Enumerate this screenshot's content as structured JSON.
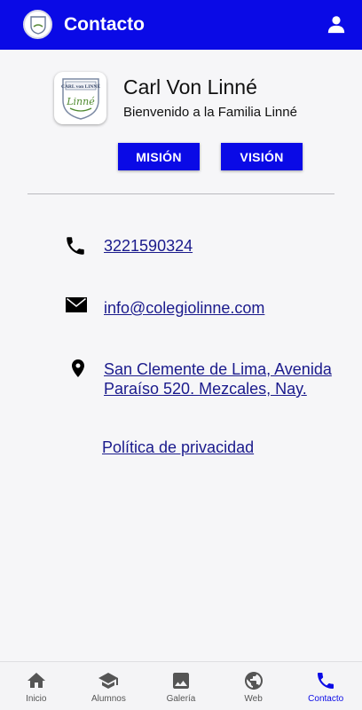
{
  "appbar": {
    "title": "Contacto",
    "logo_icon": "school-crest-icon",
    "profile_icon": "person-icon",
    "color": "#0a0ae6"
  },
  "header": {
    "logo_text_top": "CARL von LINNÉ",
    "logo_text_script": "Linné",
    "name": "Carl Von Linné",
    "welcome": "Bienvenido a la Familia Linné"
  },
  "buttons": {
    "mision": "MISIÓN",
    "vision": "VISIÓN"
  },
  "contact": {
    "phone": {
      "icon": "phone-icon",
      "text": "3221590324"
    },
    "email": {
      "icon": "envelope-icon",
      "text": "info@colegiolinne.com"
    },
    "address": {
      "icon": "location-pin-icon",
      "line1": "San Clemente de Lima, Avenida",
      "line2": "Paraíso 520. Mezcales, Nay."
    },
    "privacy": "Política de privacidad"
  },
  "nav": {
    "items": [
      {
        "label": "Inicio",
        "icon": "home-icon"
      },
      {
        "label": "Alumnos",
        "icon": "graduation-cap-icon"
      },
      {
        "label": "Galería",
        "icon": "image-icon"
      },
      {
        "label": "Web",
        "icon": "globe-icon"
      },
      {
        "label": "Contacto",
        "icon": "phone-icon",
        "active": true
      }
    ],
    "active_color": "#0a0ae6"
  }
}
